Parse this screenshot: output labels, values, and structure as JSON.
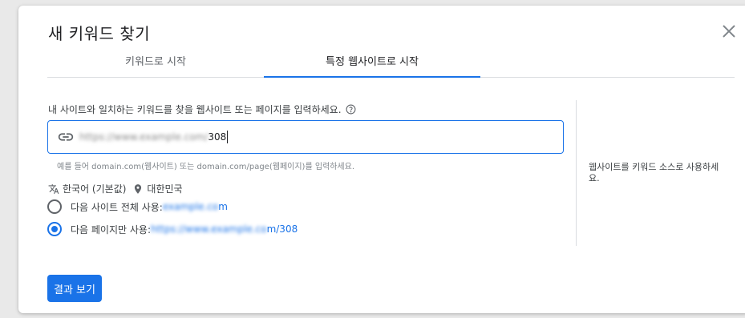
{
  "dialog": {
    "title": "새 키워드 찾기",
    "close_icon": "close-icon"
  },
  "tabs": [
    {
      "label": "키워드로 시작",
      "active": false
    },
    {
      "label": "특정 웹사이트로 시작",
      "active": true
    }
  ],
  "form": {
    "prompt": "내 사이트와 일치하는 키워드를 찾을 웹사이트 또는 페이지를 입력하세요.",
    "url_value_visible_suffix": "308",
    "hint": "예를 들어 domain.com(웹사이트) 또는 domain.com/page(웹페이지)를 입력하세요.",
    "language": "한국어 (기본값)",
    "location": "대한민국",
    "options": [
      {
        "prefix": "다음 사이트 전체 사용: ",
        "visible_suffix": "m",
        "selected": false
      },
      {
        "prefix": "다음 페이지만 사용: ",
        "visible_suffix": "m/308",
        "selected": true
      }
    ]
  },
  "side_note": "웹사이트를 키워드 소스로 사용하세요.",
  "submit_label": "결과 보기",
  "colors": {
    "accent": "#1a73e8",
    "text": "#3c4043",
    "muted": "#80868b"
  }
}
